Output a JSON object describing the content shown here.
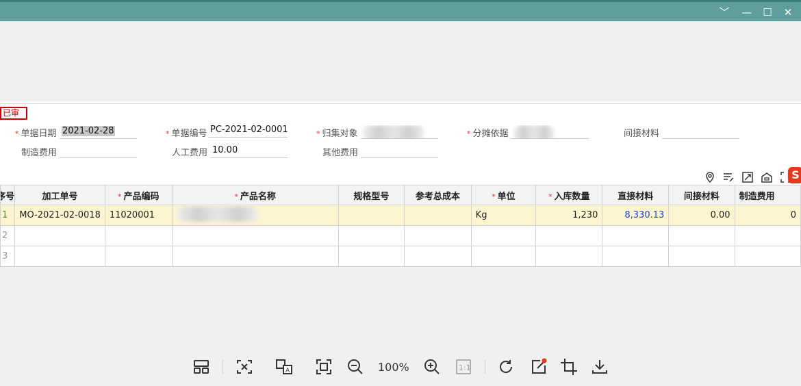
{
  "window": {
    "controls": {
      "min": "﹀",
      "restore": "—",
      "max": "☐",
      "close": "✕"
    }
  },
  "status_badge": "已审",
  "form": {
    "date_label": "单据日期",
    "date_value": "2021-02-28",
    "docno_label": "单据编号",
    "docno_value": "PC-2021-02-0001",
    "collect_label": "归集对象",
    "alloc_label": "分摊依据",
    "indirect_label": "间接材料",
    "indirect_value": "",
    "mfg_label": "制造费用",
    "mfg_value": "",
    "labor_label": "人工费用",
    "labor_value": "10.00",
    "other_label": "其他费用",
    "other_value": ""
  },
  "grid": {
    "headers": {
      "rownum": "序号",
      "order": "加工单号",
      "code": "产品编码",
      "name": "产品名称",
      "spec": "规格型号",
      "refcost": "参考总成本",
      "unit": "单位",
      "qty": "入库数量",
      "direct": "直接材料",
      "indirect": "间接材料",
      "mfg": "制造费用"
    },
    "rows": [
      {
        "rownum": "1",
        "order": "MO-2021-02-0018",
        "code": "11020001",
        "spec": "",
        "refcost": "",
        "unit": "Kg",
        "qty": "1,230",
        "direct": "8,330.13",
        "indirect": "0.00",
        "mfg": "0"
      },
      {
        "rownum": "2"
      },
      {
        "rownum": "3"
      }
    ]
  },
  "viewer_toolbar": {
    "zoom": "100%",
    "icons": [
      "layout-icon",
      "fit-width-icon",
      "ocr-translate-icon",
      "fit-screen-icon",
      "zoom-out-icon",
      "zoom-in-icon",
      "actual-size-icon",
      "rotate-icon",
      "edit-icon",
      "crop-icon",
      "download-icon"
    ]
  }
}
